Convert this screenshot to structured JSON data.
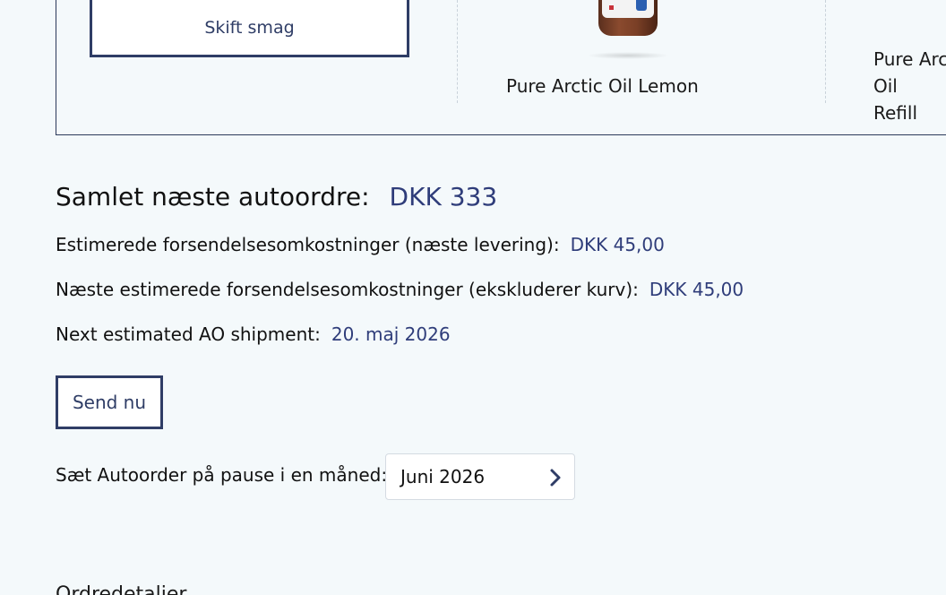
{
  "carousel": {
    "change_flavor_label": "Skift smag",
    "products": [
      {
        "name": "Pure Arctic Oil Lemon"
      },
      {
        "name": "Pure Arctic Oil Refill",
        "line1": "Pure Arctic Oil",
        "line2": "Refill"
      }
    ]
  },
  "summary": {
    "total_label": "Samlet næste autoordre:",
    "total_value": "DKK 333",
    "shipping_next_label": "Estimerede forsendelsesomkostninger (næste levering):",
    "shipping_next_value": "DKK 45,00",
    "shipping_excl_label": "Næste estimerede forsendelsesomkostninger (ekskluderer kurv):",
    "shipping_excl_value": "DKK 45,00",
    "next_shipment_label": "Next estimated AO shipment:",
    "next_shipment_value": "20. maj 2026"
  },
  "actions": {
    "send_now_label": "Send nu"
  },
  "pause": {
    "label": "Sæt Autoorder på pause i en måned:",
    "selected": "Juni 2026",
    "icon": "chevron-right-icon"
  },
  "order_details": {
    "heading": "Ordredetaljer"
  },
  "colors": {
    "accent": "#2f3d66",
    "value_text": "#2f3d7a",
    "background": "#f4f9fb"
  }
}
